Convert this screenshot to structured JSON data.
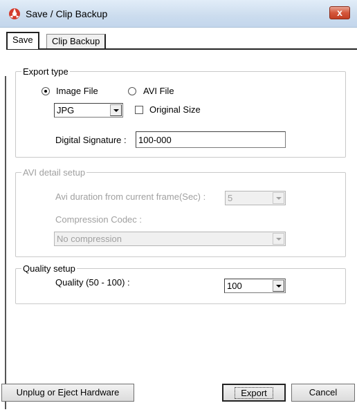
{
  "window": {
    "title": "Save / Clip Backup",
    "close_label": "x"
  },
  "tabs": [
    {
      "label": "Save"
    },
    {
      "label": "Clip Backup"
    }
  ],
  "export_type": {
    "legend": "Export type",
    "radio_image": "Image File",
    "radio_avi": "AVI File",
    "format_value": "JPG",
    "original_size_label": "Original Size",
    "signature_label": "Digital Signature :",
    "signature_value": "100-000"
  },
  "avi_setup": {
    "legend": "AVI detail setup",
    "duration_label": "Avi duration from current frame(Sec) :",
    "duration_value": "5",
    "codec_label": "Compression Codec :",
    "codec_value": "No compression"
  },
  "quality_setup": {
    "legend": "Quality setup",
    "quality_label": "Quality (50 - 100) :",
    "quality_value": "100"
  },
  "buttons": {
    "unplug": "Unplug or Eject Hardware",
    "export": "Export",
    "cancel": "Cancel"
  }
}
